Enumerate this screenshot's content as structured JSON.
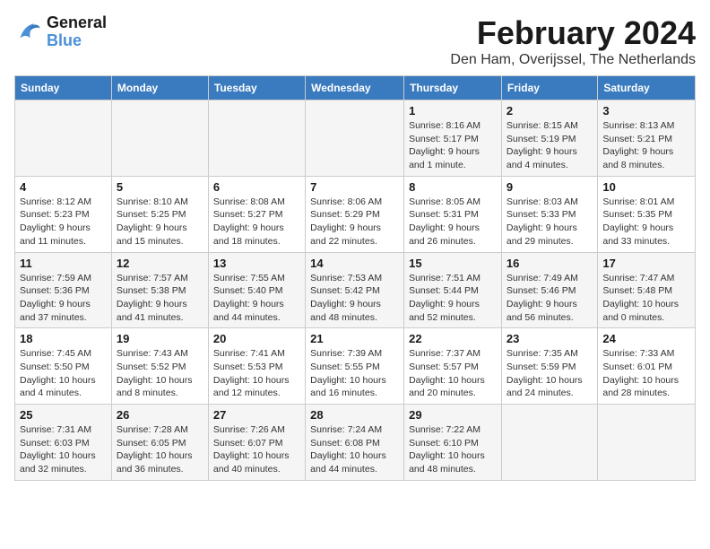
{
  "header": {
    "logo_line1": "General",
    "logo_line2": "Blue",
    "month_title": "February 2024",
    "location": "Den Ham, Overijssel, The Netherlands"
  },
  "columns": [
    "Sunday",
    "Monday",
    "Tuesday",
    "Wednesday",
    "Thursday",
    "Friday",
    "Saturday"
  ],
  "weeks": [
    [
      {
        "day": "",
        "info": ""
      },
      {
        "day": "",
        "info": ""
      },
      {
        "day": "",
        "info": ""
      },
      {
        "day": "",
        "info": ""
      },
      {
        "day": "1",
        "info": "Sunrise: 8:16 AM\nSunset: 5:17 PM\nDaylight: 9 hours\nand 1 minute."
      },
      {
        "day": "2",
        "info": "Sunrise: 8:15 AM\nSunset: 5:19 PM\nDaylight: 9 hours\nand 4 minutes."
      },
      {
        "day": "3",
        "info": "Sunrise: 8:13 AM\nSunset: 5:21 PM\nDaylight: 9 hours\nand 8 minutes."
      }
    ],
    [
      {
        "day": "4",
        "info": "Sunrise: 8:12 AM\nSunset: 5:23 PM\nDaylight: 9 hours\nand 11 minutes."
      },
      {
        "day": "5",
        "info": "Sunrise: 8:10 AM\nSunset: 5:25 PM\nDaylight: 9 hours\nand 15 minutes."
      },
      {
        "day": "6",
        "info": "Sunrise: 8:08 AM\nSunset: 5:27 PM\nDaylight: 9 hours\nand 18 minutes."
      },
      {
        "day": "7",
        "info": "Sunrise: 8:06 AM\nSunset: 5:29 PM\nDaylight: 9 hours\nand 22 minutes."
      },
      {
        "day": "8",
        "info": "Sunrise: 8:05 AM\nSunset: 5:31 PM\nDaylight: 9 hours\nand 26 minutes."
      },
      {
        "day": "9",
        "info": "Sunrise: 8:03 AM\nSunset: 5:33 PM\nDaylight: 9 hours\nand 29 minutes."
      },
      {
        "day": "10",
        "info": "Sunrise: 8:01 AM\nSunset: 5:35 PM\nDaylight: 9 hours\nand 33 minutes."
      }
    ],
    [
      {
        "day": "11",
        "info": "Sunrise: 7:59 AM\nSunset: 5:36 PM\nDaylight: 9 hours\nand 37 minutes."
      },
      {
        "day": "12",
        "info": "Sunrise: 7:57 AM\nSunset: 5:38 PM\nDaylight: 9 hours\nand 41 minutes."
      },
      {
        "day": "13",
        "info": "Sunrise: 7:55 AM\nSunset: 5:40 PM\nDaylight: 9 hours\nand 44 minutes."
      },
      {
        "day": "14",
        "info": "Sunrise: 7:53 AM\nSunset: 5:42 PM\nDaylight: 9 hours\nand 48 minutes."
      },
      {
        "day": "15",
        "info": "Sunrise: 7:51 AM\nSunset: 5:44 PM\nDaylight: 9 hours\nand 52 minutes."
      },
      {
        "day": "16",
        "info": "Sunrise: 7:49 AM\nSunset: 5:46 PM\nDaylight: 9 hours\nand 56 minutes."
      },
      {
        "day": "17",
        "info": "Sunrise: 7:47 AM\nSunset: 5:48 PM\nDaylight: 10 hours\nand 0 minutes."
      }
    ],
    [
      {
        "day": "18",
        "info": "Sunrise: 7:45 AM\nSunset: 5:50 PM\nDaylight: 10 hours\nand 4 minutes."
      },
      {
        "day": "19",
        "info": "Sunrise: 7:43 AM\nSunset: 5:52 PM\nDaylight: 10 hours\nand 8 minutes."
      },
      {
        "day": "20",
        "info": "Sunrise: 7:41 AM\nSunset: 5:53 PM\nDaylight: 10 hours\nand 12 minutes."
      },
      {
        "day": "21",
        "info": "Sunrise: 7:39 AM\nSunset: 5:55 PM\nDaylight: 10 hours\nand 16 minutes."
      },
      {
        "day": "22",
        "info": "Sunrise: 7:37 AM\nSunset: 5:57 PM\nDaylight: 10 hours\nand 20 minutes."
      },
      {
        "day": "23",
        "info": "Sunrise: 7:35 AM\nSunset: 5:59 PM\nDaylight: 10 hours\nand 24 minutes."
      },
      {
        "day": "24",
        "info": "Sunrise: 7:33 AM\nSunset: 6:01 PM\nDaylight: 10 hours\nand 28 minutes."
      }
    ],
    [
      {
        "day": "25",
        "info": "Sunrise: 7:31 AM\nSunset: 6:03 PM\nDaylight: 10 hours\nand 32 minutes."
      },
      {
        "day": "26",
        "info": "Sunrise: 7:28 AM\nSunset: 6:05 PM\nDaylight: 10 hours\nand 36 minutes."
      },
      {
        "day": "27",
        "info": "Sunrise: 7:26 AM\nSunset: 6:07 PM\nDaylight: 10 hours\nand 40 minutes."
      },
      {
        "day": "28",
        "info": "Sunrise: 7:24 AM\nSunset: 6:08 PM\nDaylight: 10 hours\nand 44 minutes."
      },
      {
        "day": "29",
        "info": "Sunrise: 7:22 AM\nSunset: 6:10 PM\nDaylight: 10 hours\nand 48 minutes."
      },
      {
        "day": "",
        "info": ""
      },
      {
        "day": "",
        "info": ""
      }
    ]
  ]
}
